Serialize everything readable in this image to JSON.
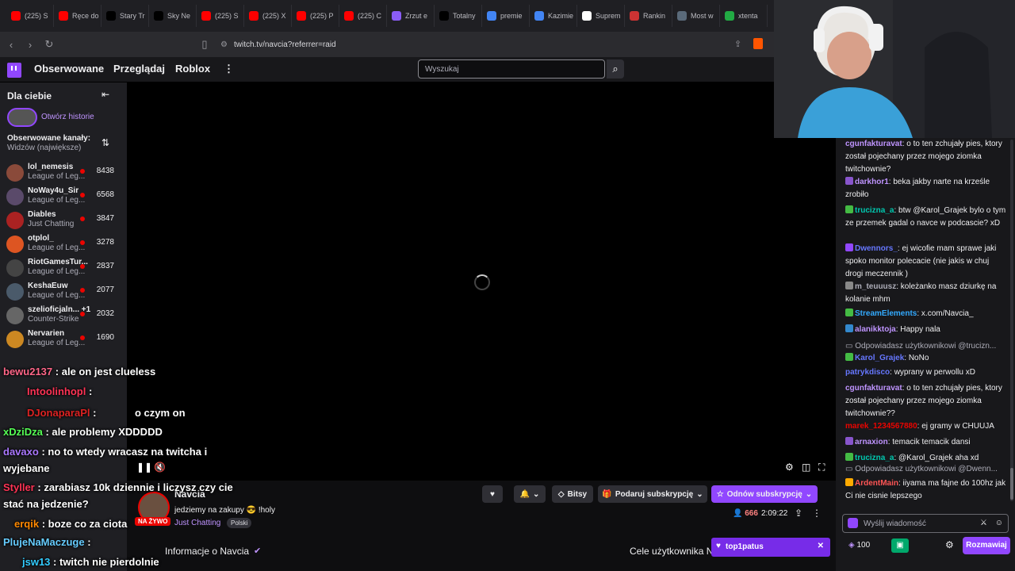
{
  "browser": {
    "tabs": [
      {
        "label": "(225) S",
        "color": "#ff0000"
      },
      {
        "label": "Ręce do",
        "color": "#ff0000"
      },
      {
        "label": "Stary Tr",
        "color": "#000000"
      },
      {
        "label": "Sky Ne",
        "color": "#000000"
      },
      {
        "label": "(225) S",
        "color": "#ff0000"
      },
      {
        "label": "(225) X",
        "color": "#ff0000"
      },
      {
        "label": "(225) P",
        "color": "#ff0000"
      },
      {
        "label": "(225) C",
        "color": "#ff0000"
      },
      {
        "label": "Zrzut e",
        "color": "#8a5cf6"
      },
      {
        "label": "Totalny",
        "color": "#000000"
      },
      {
        "label": "premie",
        "color": "#4285f4"
      },
      {
        "label": "Kazimie",
        "color": "#4285f4"
      },
      {
        "label": "Suprem",
        "color": "#ffffff"
      },
      {
        "label": "Rankin",
        "color": "#cc3333"
      },
      {
        "label": "Most w",
        "color": "#5a6a7a"
      },
      {
        "label": "xtenta",
        "color": "#22aa44"
      }
    ],
    "url": "twitch.tv/navcia?referrer=raid"
  },
  "topnav": {
    "followed": "Obserwowane",
    "browse": "Przeglądaj",
    "roblox": "Roblox",
    "more": "⋮",
    "search_placeholder": "Wyszukaj"
  },
  "sidebar": {
    "title": "Dla ciebie",
    "history": "Otwórz historie",
    "followed_label": "Obserwowane kanały:",
    "followed_sort": "Widzów (największe)",
    "channels": [
      {
        "name": "lol_nemesis",
        "game": "League of Leg...",
        "viewers": "8438",
        "color": "#8a4a3a"
      },
      {
        "name": "NoWay4u_Sir",
        "game": "League of Leg...",
        "viewers": "6568",
        "color": "#5a4a6a"
      },
      {
        "name": "Diables",
        "game": "Just Chatting",
        "viewers": "3847",
        "color": "#aa2222"
      },
      {
        "name": "otplol_",
        "game": "League of Leg...",
        "viewers": "3278",
        "color": "#dd5522"
      },
      {
        "name": "RiotGamesTur...",
        "game": "League of Leg...",
        "viewers": "2837",
        "color": "#444444"
      },
      {
        "name": "KeshaEuw",
        "game": "League of Leg...",
        "viewers": "2077",
        "color": "#4a5a6a"
      },
      {
        "name": "szelioficjaln... +1",
        "game": "Counter-Strike",
        "viewers": "2032",
        "color": "#666666"
      },
      {
        "name": "Nervarien",
        "game": "League of Leg...",
        "viewers": "1690",
        "color": "#cc8822"
      }
    ]
  },
  "overlay_chat": [
    {
      "user": "bewu2137",
      "text": ": ale on jest clueless",
      "color": "#ff6688"
    },
    {
      "user": "Intoolinhopl",
      "text": ":",
      "color": "#ff3355"
    },
    {
      "user": "DJonaparaPl",
      "text": ":",
      "color": "#dd2222"
    },
    {
      "user": "",
      "text": "o czym on",
      "color": "#ffffff"
    },
    {
      "user": "xDziDza",
      "text": ": ale problemy XDDDDD",
      "color": "#55ff55"
    },
    {
      "user": "davaxo",
      "text": ": no to wtedy wracasz na twitcha i",
      "color": "#aa77ff"
    },
    {
      "user": "",
      "text": "wyjebane",
      "color": "#ffffff"
    },
    {
      "user": "Styller",
      "text": ": zarabiasz 10k dziennie i liczysz czy cie",
      "color": "#ff3355"
    },
    {
      "user": "",
      "text": "stać na jedzenie?",
      "color": "#ffffff"
    },
    {
      "user": "erqik",
      "text": ": boze co za ciota",
      "color": "#ff8800"
    },
    {
      "user": "PlujeNaMaczuge",
      "text": ":",
      "color": "#66ccff"
    },
    {
      "user": "jsw13",
      "text": ": twitch nie pierdolnie",
      "color": "#33ccff"
    }
  ],
  "stream": {
    "channel": "Navcia",
    "title": "jedziemy na zakupy 😎 !holy",
    "live": "NA ŻYWO",
    "category": "Just Chatting",
    "language": "Polski",
    "viewers": "666",
    "uptime": "2:09:22",
    "bits": "Bitsy",
    "gift_sub": "Podaruj subskrypcję",
    "renew_sub": "Odnów subskrypcję",
    "about": "Informacje o Navcia",
    "goals": "Cele użytkownika N"
  },
  "chat": {
    "messages": [
      {
        "user": "cgunfakturavat",
        "text": ": o to ten zchujały pies, ktory został pojechany przez mojego ziomka twitchownie?",
        "color": "#bf94ff",
        "badge": ""
      },
      {
        "user": "darkhor1",
        "text": ": beka jakby narte na krześle zrobiło",
        "color": "#bf94ff",
        "badge": "#8855cc"
      },
      {
        "user": "trucizna_a",
        "text": ": btw @Karol_Grajek bylo o tym ze przemek gadal o navce w podcascie? xD",
        "color": "#00c8af",
        "badge": "#44bb44"
      },
      {
        "user": "Dwennors_",
        "text": ": ej wicofie mam sprawe jaki spoko monitor polecacie (nie jakis w chuj drogi meczennik )",
        "color": "#6677ff",
        "badge": "#9147ff"
      },
      {
        "user": "m_teuuusz",
        "text": ": koleżanko masz dziurkę na kolanie mhm",
        "color": "#adadb8",
        "badge": "#888888"
      },
      {
        "user": "StreamElements",
        "text": ": x.com/Navcia_",
        "color": "#33aaff",
        "badge": "#44bb44"
      },
      {
        "user": "alanikktoja",
        "text": ": Happy nala",
        "color": "#bf94ff",
        "badge": "#3388cc"
      },
      {
        "user": "",
        "text": "Odpowiadasz użytkownikowi @trucizn...",
        "color": "#adadb8",
        "badge": ""
      },
      {
        "user": "Karol_Grajek",
        "text": ": NoNo",
        "color": "#6677ff",
        "badge": "#44bb44"
      },
      {
        "user": "patrykdisco",
        "text": ": wyprany w perwollu xD",
        "color": "#6677ff",
        "badge": ""
      },
      {
        "user": "cgunfakturavat",
        "text": ": o to ten zchujały pies, ktory został pojechany przez mojego ziomka twitchownie??",
        "color": "#bf94ff",
        "badge": ""
      },
      {
        "user": "marek_1234567880",
        "text": ": ej gramy w CHUUJA",
        "color": "#eb0400",
        "badge": ""
      },
      {
        "user": "arnaxion",
        "text": ": temacik temacik dansi",
        "color": "#bf94ff",
        "badge": "#8855cc"
      },
      {
        "user": "trucizna_a",
        "text": ": @Karol_Grajek aha xd",
        "color": "#00c8af",
        "badge": "#44bb44"
      },
      {
        "user": "",
        "text": "Odpowiadasz użytkownikowi @Dwenn...",
        "color": "#adadb8",
        "badge": ""
      },
      {
        "user": "ArdentMain",
        "text": ": iiyama ma fajne do 100hz jak Ci nie cisnie lepszego",
        "color": "#ff5555",
        "badge": "#ffaa00"
      }
    ],
    "input_placeholder": "Wyślij wiadomość",
    "points": "100",
    "chat_button": "Rozmawiaj",
    "notification": "top1patus"
  },
  "colors": {
    "accent": "#9147ff",
    "live": "#eb0400"
  }
}
